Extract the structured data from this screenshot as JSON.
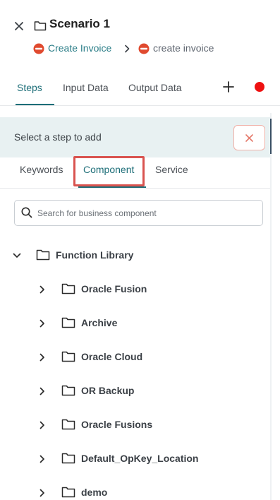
{
  "header": {
    "title": "Scenario 1",
    "breadcrumb": {
      "parent_label": "Create Invoice",
      "current_label": "create invoice"
    }
  },
  "tabs": {
    "steps": "Steps",
    "input_data": "Input Data",
    "output_data": "Output Data",
    "active": "Steps"
  },
  "banner": {
    "text": "Select a step to add"
  },
  "sub_tabs": {
    "keywords": "Keywords",
    "component": "Component",
    "service": "Service",
    "active": "Component"
  },
  "search": {
    "placeholder": "Search for business component",
    "value": ""
  },
  "tree": {
    "root": {
      "label": "Function Library",
      "expanded": true
    },
    "children": [
      "Oracle Fusion",
      "Archive",
      "Oracle Cloud",
      "OR Backup",
      "Oracle Fusions",
      "Default_OpKey_Location",
      "demo"
    ]
  },
  "colors": {
    "accent": "#1d6e78",
    "link": "#2a7d87",
    "record": "#ee1111",
    "highlight": "#d9534f",
    "banner_bg": "#e8f1f2"
  }
}
